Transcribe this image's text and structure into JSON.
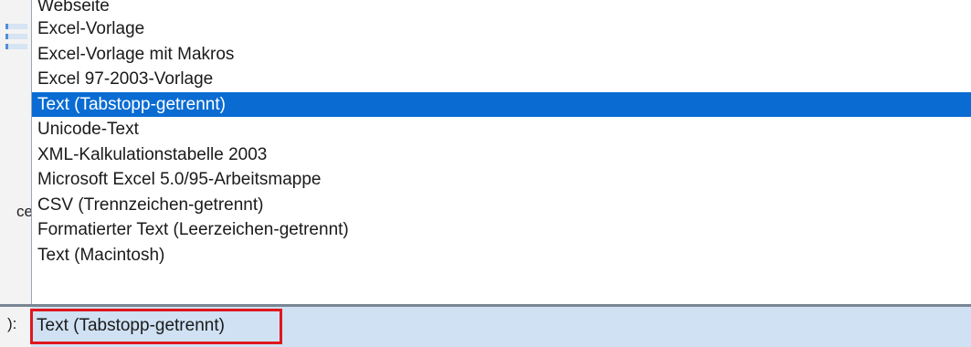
{
  "background": {
    "partial_label": "cel",
    "partial_colon": "):"
  },
  "dropdown": {
    "options": [
      "Webseite",
      "Excel-Vorlage",
      "Excel-Vorlage mit Makros",
      "Excel 97-2003-Vorlage",
      "Text (Tabstopp-getrennt)",
      "Unicode-Text",
      "XML-Kalkulationstabelle 2003",
      "Microsoft Excel 5.0/95-Arbeitsmappe",
      "CSV (Trennzeichen-getrennt)",
      "Formatierter Text (Leerzeichen-getrennt)",
      "Text (Macintosh)"
    ],
    "selected_index": 4
  },
  "file_type_field": {
    "value": "Text (Tabstopp-getrennt)"
  },
  "colors": {
    "selection": "#0a6cd2",
    "field_background": "#cfe1f3",
    "highlight_border": "#e0161e"
  }
}
